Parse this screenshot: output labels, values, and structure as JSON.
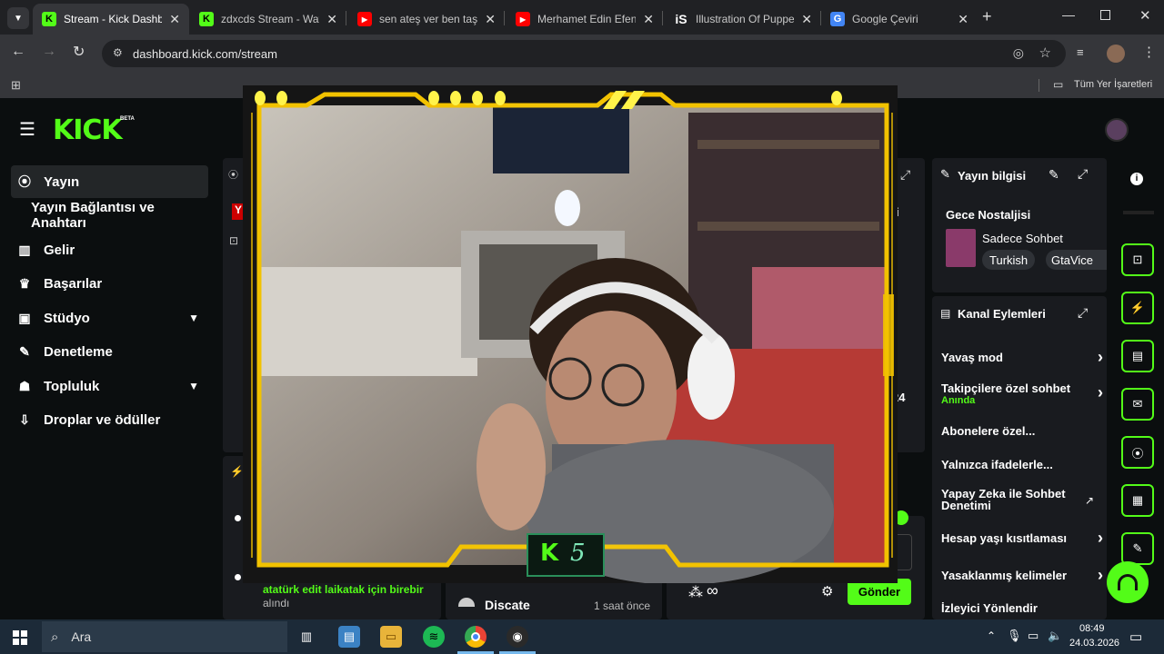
{
  "browser": {
    "tabs": [
      {
        "title": "Stream - Kick Dashbo",
        "favicon": "kick-logo-icon",
        "active": true
      },
      {
        "title": "zdxcds Stream - Watc",
        "favicon": "kick-logo-icon",
        "active": false
      },
      {
        "title": "sen ateş ver ben taş v",
        "favicon": "youtube-icon",
        "active": false
      },
      {
        "title": "Merhamet Edin Efend",
        "favicon": "youtube-icon",
        "active": false
      },
      {
        "title": "Illustration Of Puppe",
        "favicon": "istock-icon",
        "active": false
      },
      {
        "title": "Google Çeviri",
        "favicon": "google-translate-icon",
        "active": false
      }
    ],
    "url": "dashboard.kick.com/stream",
    "bookmarks_label": "Tüm Yer İşaretleri"
  },
  "brand": {
    "logo": "KICK",
    "beta": "BETA",
    "accent": "#53fc18"
  },
  "sidebar": {
    "items": [
      {
        "label": "Yayın",
        "icon": "broadcast-icon",
        "active": true
      },
      {
        "label": "Yayın Bağlantısı ve Anahtarı",
        "icon": "",
        "sub": true
      },
      {
        "label": "Gelir",
        "icon": "chart-icon"
      },
      {
        "label": "Başarılar",
        "icon": "trophy-icon"
      },
      {
        "label": "Stüdyo",
        "icon": "studio-icon",
        "expandable": true
      },
      {
        "label": "Denetleme",
        "icon": "wrench-icon"
      },
      {
        "label": "Topluluk",
        "icon": "community-icon",
        "expandable": true
      },
      {
        "label": "Droplar ve ödüller",
        "icon": "drops-icon"
      }
    ]
  },
  "stream_info": {
    "header": "Yayın bilgisi",
    "title": "Gece Nostaljisi",
    "category": "Sadece Sohbet",
    "tags": [
      "Turkish",
      "GtaVice"
    ]
  },
  "channel_actions": {
    "header": "Kanal Eylemleri",
    "items": [
      {
        "label": "Yavaş mod",
        "type": "arrow"
      },
      {
        "label": "Takipçilere özel sohbet",
        "sub": "Anında",
        "type": "arrow"
      },
      {
        "label": "Abonelere özel...",
        "type": "toggle"
      },
      {
        "label": "Yalnızca ifadelerle...",
        "type": "toggle"
      },
      {
        "label": "Yapay Zeka ile Sohbet Denetimi",
        "type": "external"
      },
      {
        "label": "Hesap yaşı kısıtlaması",
        "type": "arrow"
      },
      {
        "label": "Yasaklanmış kelimeler",
        "type": "arrow"
      },
      {
        "label": "İzleyici Yönlendir",
        "type": "none"
      }
    ]
  },
  "chat": {
    "message": "atatürk edit laikatak için birebir",
    "status": "alındı",
    "activity_user": "Discate",
    "activity_time": "1 saat önce",
    "send_label": "Gönder",
    "infinity": "∞"
  },
  "overlay": {
    "badge_letter": "K",
    "badge_number": "5"
  },
  "partial_text": {
    "y_badge": "Y",
    "right_i": "i",
    "right_num": "24"
  },
  "taskbar": {
    "search": "Ara",
    "time": "08:49",
    "date": "24.03.2026"
  }
}
